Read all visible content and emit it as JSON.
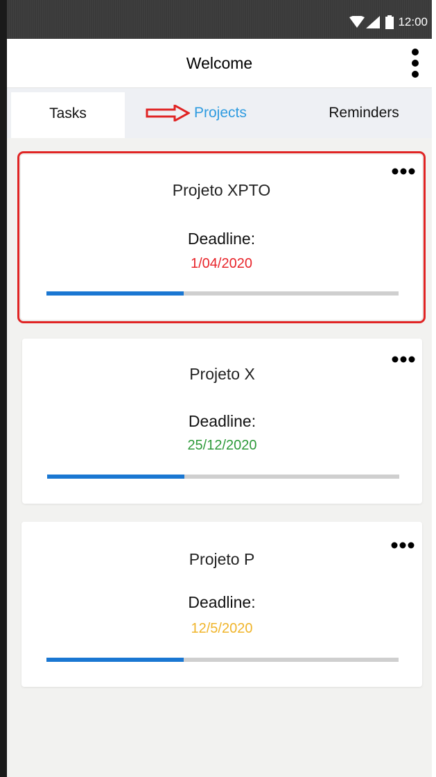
{
  "status_bar": {
    "time": "12:00",
    "icons": [
      "wifi-icon",
      "signal-icon",
      "battery-icon"
    ]
  },
  "app_bar": {
    "title": "Welcome",
    "menu_icon": "more-vert-icon"
  },
  "tabs": [
    {
      "label": "Tasks",
      "selected": true
    },
    {
      "label": "Projects",
      "selected": false,
      "annotation": "red-arrow-icon"
    },
    {
      "label": "Reminders",
      "selected": false
    }
  ],
  "projects": [
    {
      "name": "Projeto XPTO",
      "deadline_label": "Deadline:",
      "deadline": "1/04/2020",
      "deadline_color": "#e8242a",
      "progress": 0.39,
      "highlighted": true
    },
    {
      "name": "Projeto X",
      "deadline_label": "Deadline:",
      "deadline": "25/12/2020",
      "deadline_color": "#2e9a3a",
      "progress": 0.39,
      "highlighted": false
    },
    {
      "name": "Projeto P",
      "deadline_label": "Deadline:",
      "deadline": "12/5/2020",
      "deadline_color": "#f0b429",
      "progress": 0.39,
      "highlighted": false
    }
  ],
  "colors": {
    "accent": "#2e9be0",
    "progress": "#1a77d2",
    "highlight": "#e02424"
  }
}
